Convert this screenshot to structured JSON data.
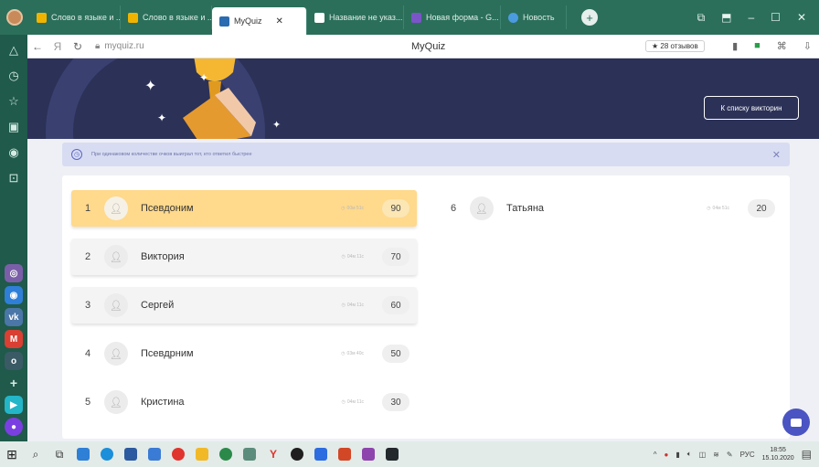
{
  "browser": {
    "tabs": [
      {
        "label": "Слово в языке и ...",
        "color": "#f0b400"
      },
      {
        "label": "Слово в языке и ...",
        "color": "#f0b400"
      },
      {
        "label": "MyQuiz",
        "color": "#2b6bb0",
        "active": true
      },
      {
        "label": "Название не указ...",
        "color": "#ffffff"
      },
      {
        "label": "Новая форма - G...",
        "color": "#7a55c8"
      },
      {
        "label": "Новость",
        "color": "#4b9be0"
      }
    ],
    "url": "myquiz.ru",
    "page_title": "MyQuiz",
    "reviews": "★ 28 отзывов"
  },
  "banner": {
    "back_button": "К списку викторин"
  },
  "notice": {
    "text": "При одинаковом количестве очков выиграл тот, кто ответил быстрее"
  },
  "leaderboard": {
    "left": [
      {
        "rank": "1",
        "name": "Псевдоним",
        "time": "00м 51с",
        "score": "90"
      },
      {
        "rank": "2",
        "name": "Виктория",
        "time": "04м 11с",
        "score": "70"
      },
      {
        "rank": "3",
        "name": "Сергей",
        "time": "04м 11с",
        "score": "60"
      },
      {
        "rank": "4",
        "name": "Псевдрним",
        "time": "03м 40с",
        "score": "50"
      },
      {
        "rank": "5",
        "name": "Кристина",
        "time": "04м 11с",
        "score": "30"
      }
    ],
    "right": [
      {
        "rank": "6",
        "name": "Татьяна",
        "time": "04м 51с",
        "score": "20"
      }
    ]
  },
  "taskbar": {
    "lang": "РУС",
    "time": "18:55",
    "date": "15.10.2020"
  },
  "colors": {
    "banner": "#2b3157",
    "first_place": "#ffd98c",
    "notice_bg": "#d8dcf2",
    "chat_button": "#4a54c2"
  }
}
